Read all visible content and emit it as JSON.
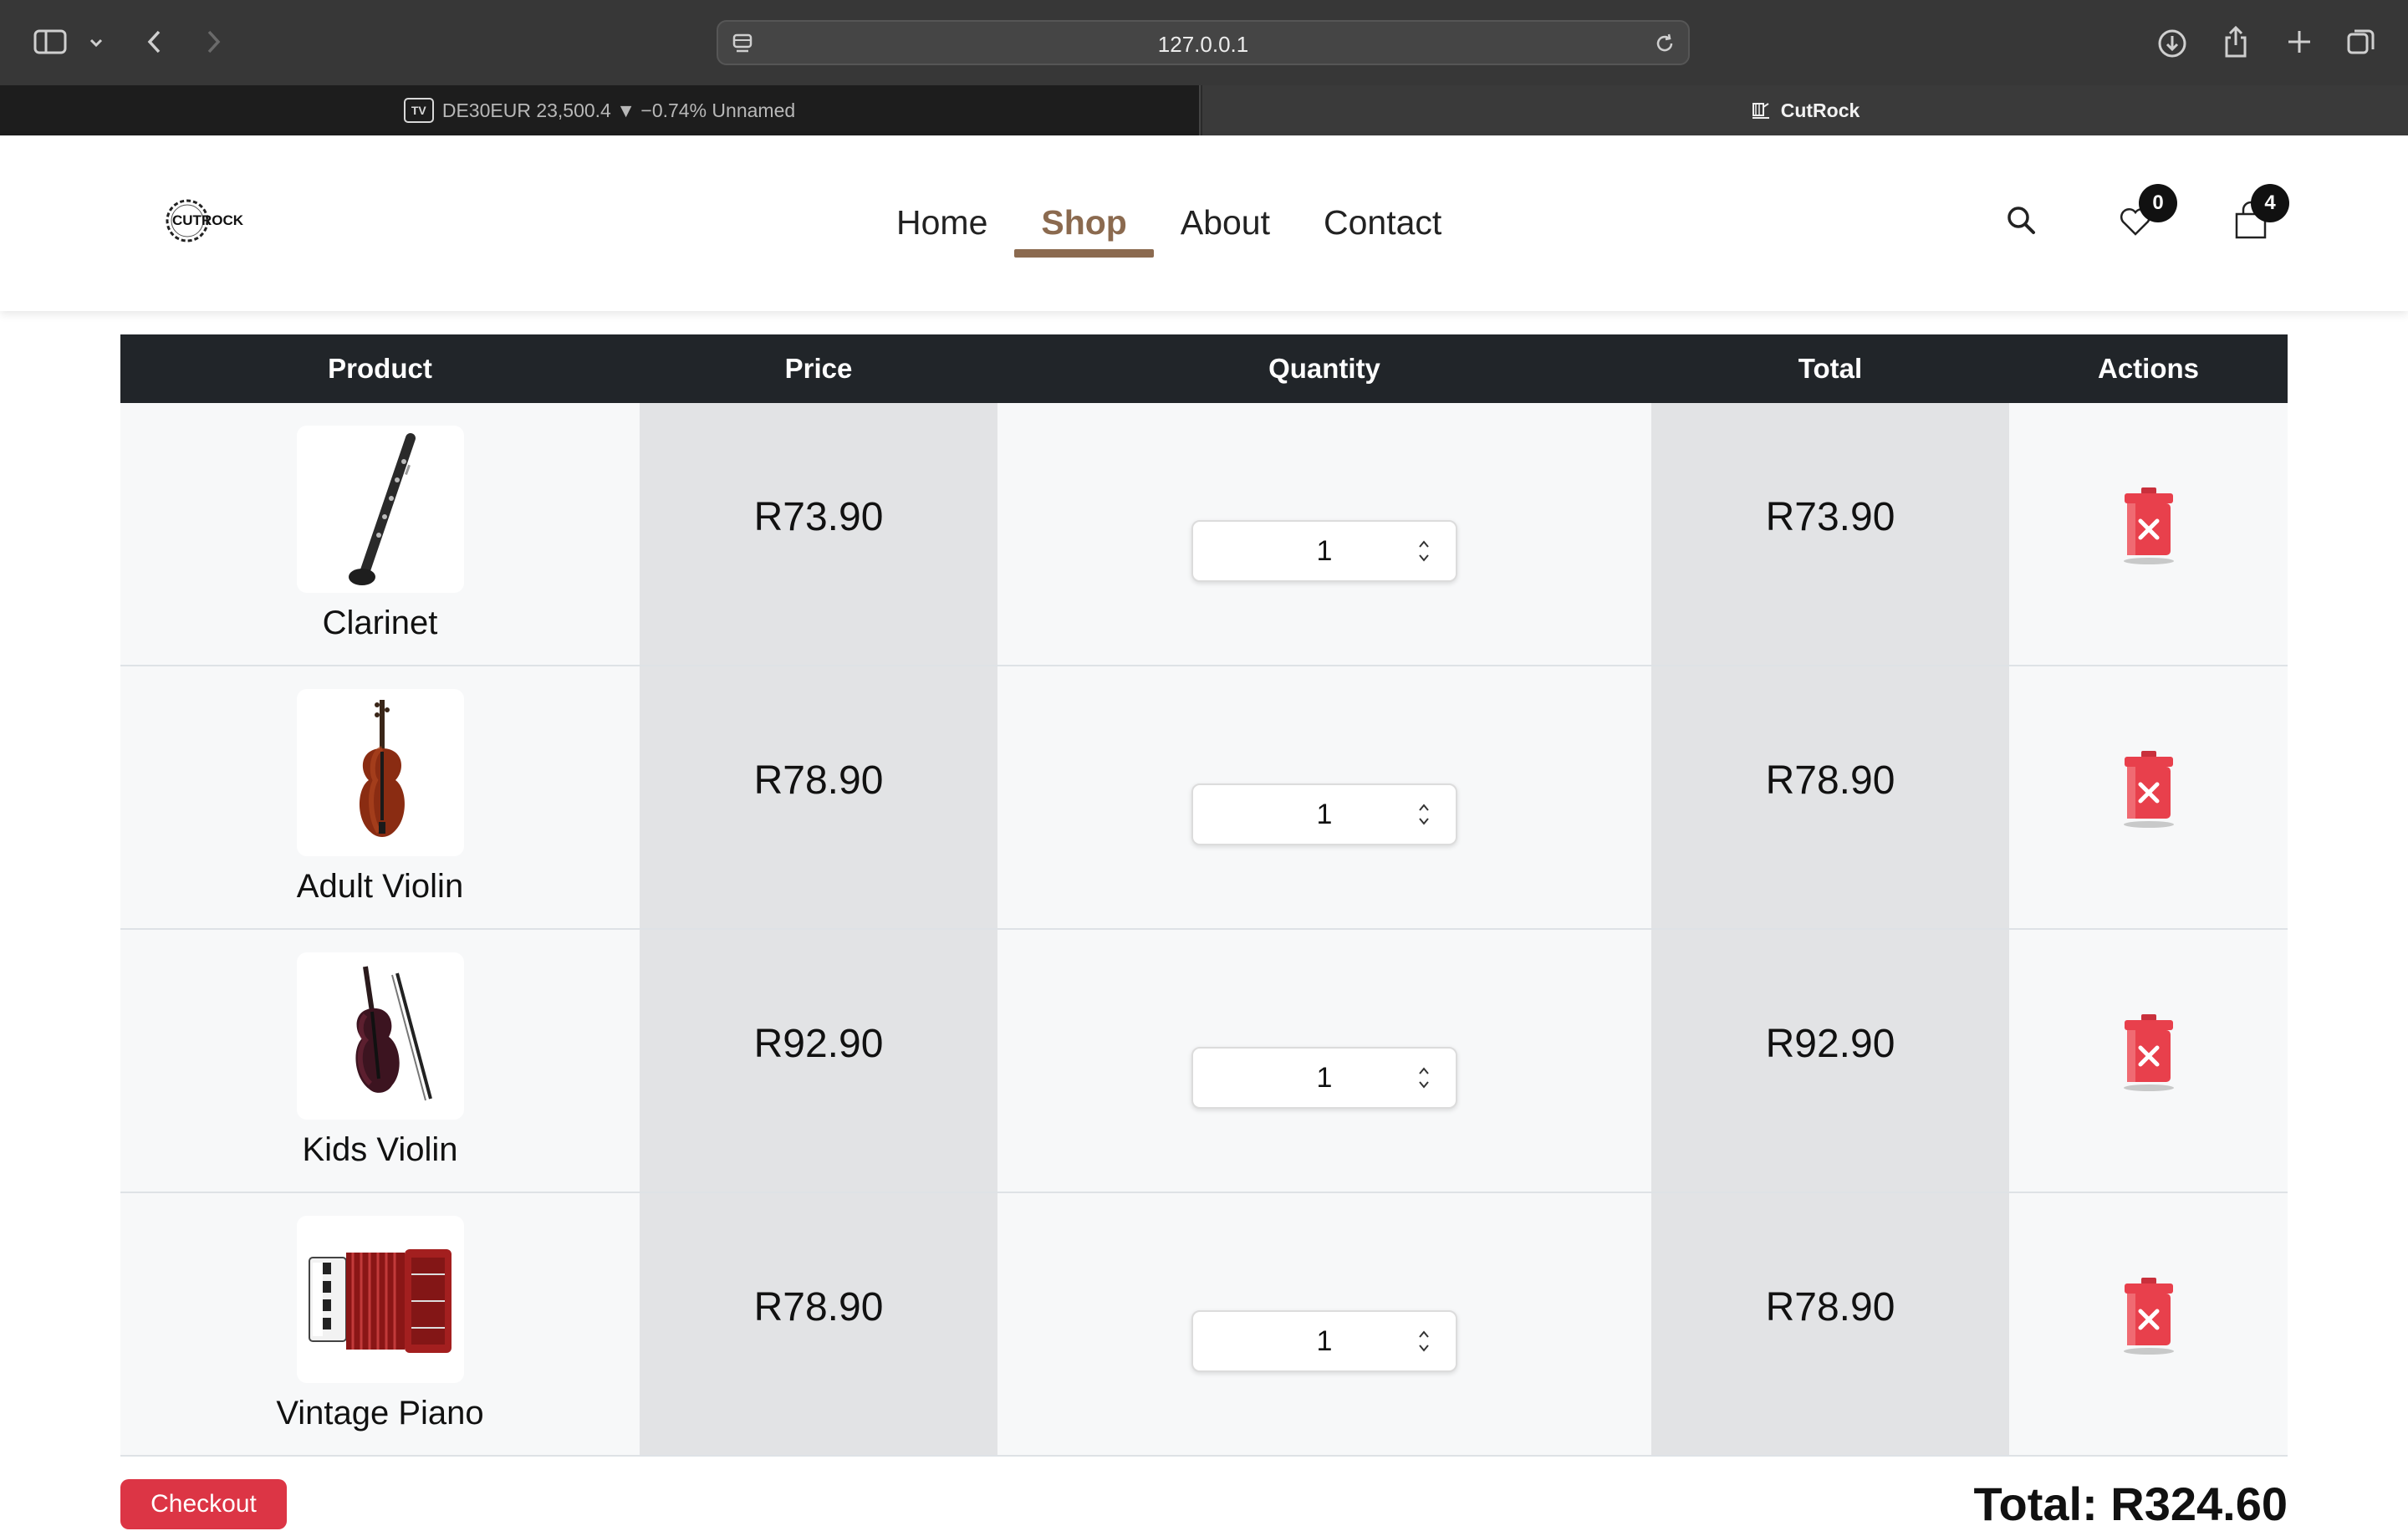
{
  "browser": {
    "url": "127.0.0.1",
    "tabs": [
      {
        "label": "DE30EUR 23,500.4 ▼ −0.74% Unnamed",
        "icon": "tradingview-icon",
        "icon_text": "TV"
      },
      {
        "label": "CutRock",
        "icon": "cutrock-favicon"
      }
    ]
  },
  "site": {
    "logo_text": "CUTROCK",
    "nav": [
      "Home",
      "Shop",
      "About",
      "Contact"
    ],
    "active_nav": "Shop",
    "wishlist_count": "0",
    "cart_count": "4"
  },
  "cart": {
    "headers": [
      "Product",
      "Price",
      "Quantity",
      "Total",
      "Actions"
    ],
    "rows": [
      {
        "name": "Clarinet",
        "price": "R73.90",
        "qty": "1",
        "total": "R73.90",
        "image": "clarinet"
      },
      {
        "name": "Adult Violin",
        "price": "R78.90",
        "qty": "1",
        "total": "R78.90",
        "image": "violin"
      },
      {
        "name": "Kids Violin",
        "price": "R92.90",
        "qty": "1",
        "total": "R92.90",
        "image": "kids-violin"
      },
      {
        "name": "Vintage Piano",
        "price": "R78.90",
        "qty": "1",
        "total": "R78.90",
        "image": "accordion"
      }
    ],
    "checkout_label": "Checkout",
    "grand_total": "Total: R324.60"
  },
  "colors": {
    "accent": "#8b6a4f",
    "header_dark": "#212529",
    "delete_red": "#e8404c",
    "button_red": "#dc3545"
  }
}
